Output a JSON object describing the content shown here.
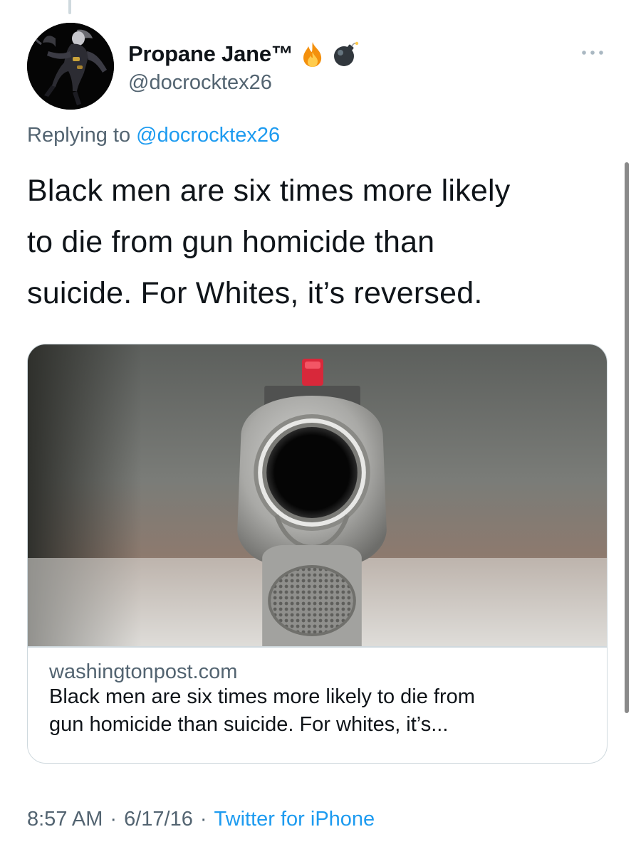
{
  "tweet": {
    "display_name": "Propane Jane™",
    "handle": "@docrocktex26",
    "name_emojis": [
      "fire-emoji",
      "bomb-emoji"
    ],
    "more_icon": "more-options-icon",
    "reply_prefix": "Replying to",
    "reply_to": "@docrocktex26",
    "text_lines": [
      "Black men are six times more likely",
      "to die from gun homicide than",
      "suicide. For Whites, it’s reversed."
    ],
    "card": {
      "domain": "washingtonpost.com",
      "title_lines": [
        "Black men are six times more likely to die from",
        "gun homicide than suicide. For whites, it’s..."
      ]
    },
    "time": "8:57 AM",
    "separator": "·",
    "date": "6/17/16",
    "source": "Twitter for iPhone"
  },
  "colors": {
    "text_primary": "#0f1419",
    "text_secondary": "#536471",
    "link": "#1d9bf0",
    "border": "#cfd9de"
  }
}
